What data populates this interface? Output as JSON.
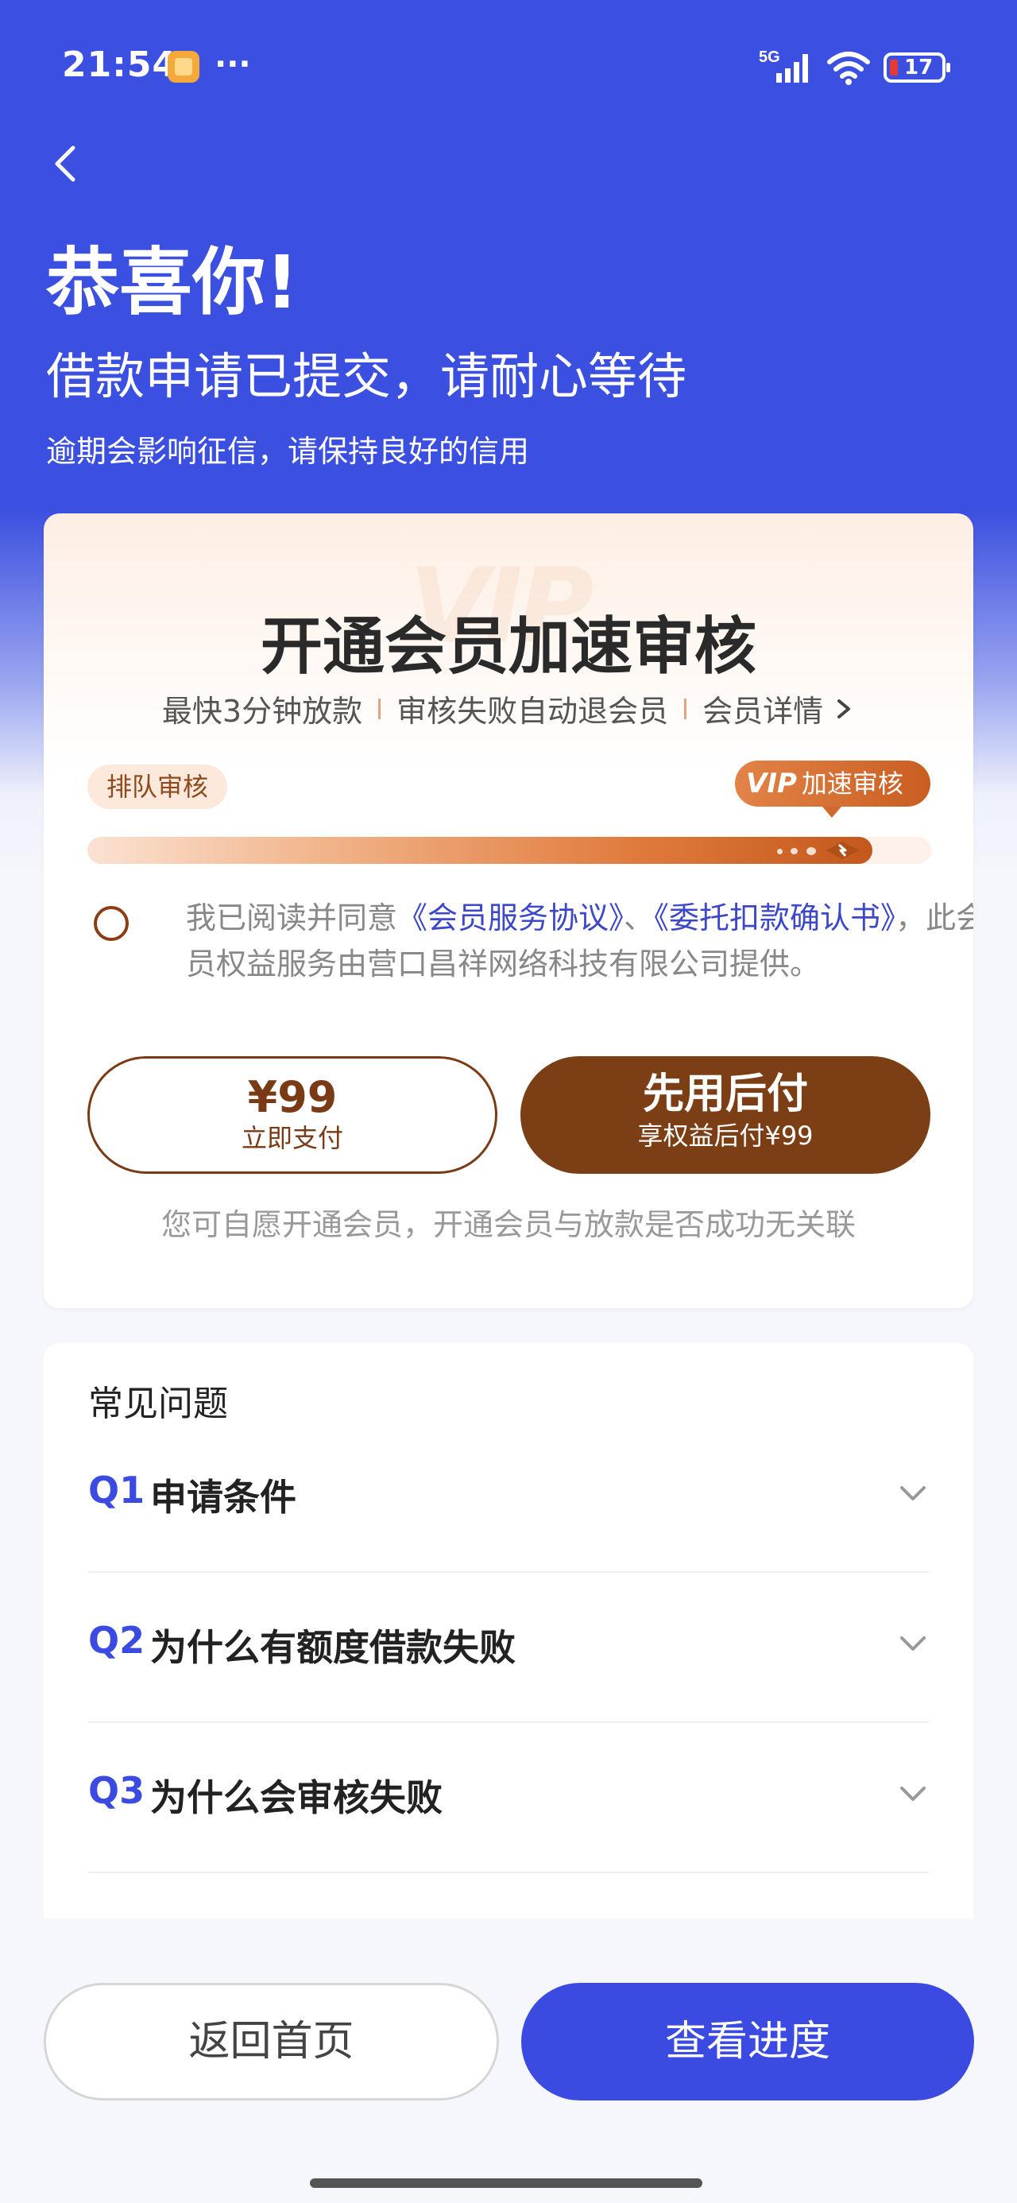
{
  "status_bar": {
    "time": "21:54",
    "dots": "···",
    "network": "5G",
    "battery": "17"
  },
  "hero": {
    "title": "恭喜你!",
    "subtitle": "借款申请已提交，请耐心等待",
    "note": "逾期会影响征信，请保持良好的信用"
  },
  "vip": {
    "watermark": "VIP",
    "title": "开通会员加速审核",
    "features": [
      "最快3分钟放款",
      "审核失败自动退会员",
      "会员详情"
    ],
    "queue_tag": "排队审核",
    "vip_tag_mark": "VIP",
    "vip_tag_text": "加速审核",
    "progress": 0.93,
    "agreement": {
      "prefix": "我已阅读并同意",
      "link1": "《会员服务协议》",
      "sep": "、",
      "link2": "《委托扣款确认书》",
      "suffix": "，此会员权益服务由营口昌祥网络科技有限公司提供。"
    },
    "pay_button": {
      "price": "¥99",
      "sub": "立即支付"
    },
    "later_button": {
      "main": "先用后付",
      "sub": "享权益后付¥99"
    },
    "disclaimer": "您可自愿开通会员，开通会员与放款是否成功无关联"
  },
  "faq": {
    "title": "常见问题",
    "items": [
      {
        "q": "Q1",
        "text": "申请条件"
      },
      {
        "q": "Q2",
        "text": "为什么有额度借款失败"
      },
      {
        "q": "Q3",
        "text": "为什么会审核失败"
      }
    ]
  },
  "bottom": {
    "home_label": "返回首页",
    "progress_label": "查看进度"
  },
  "colors": {
    "brand_blue": "#3b4ae0",
    "vip_brown": "#7b3e15",
    "vip_orange": "#e07a3c"
  }
}
